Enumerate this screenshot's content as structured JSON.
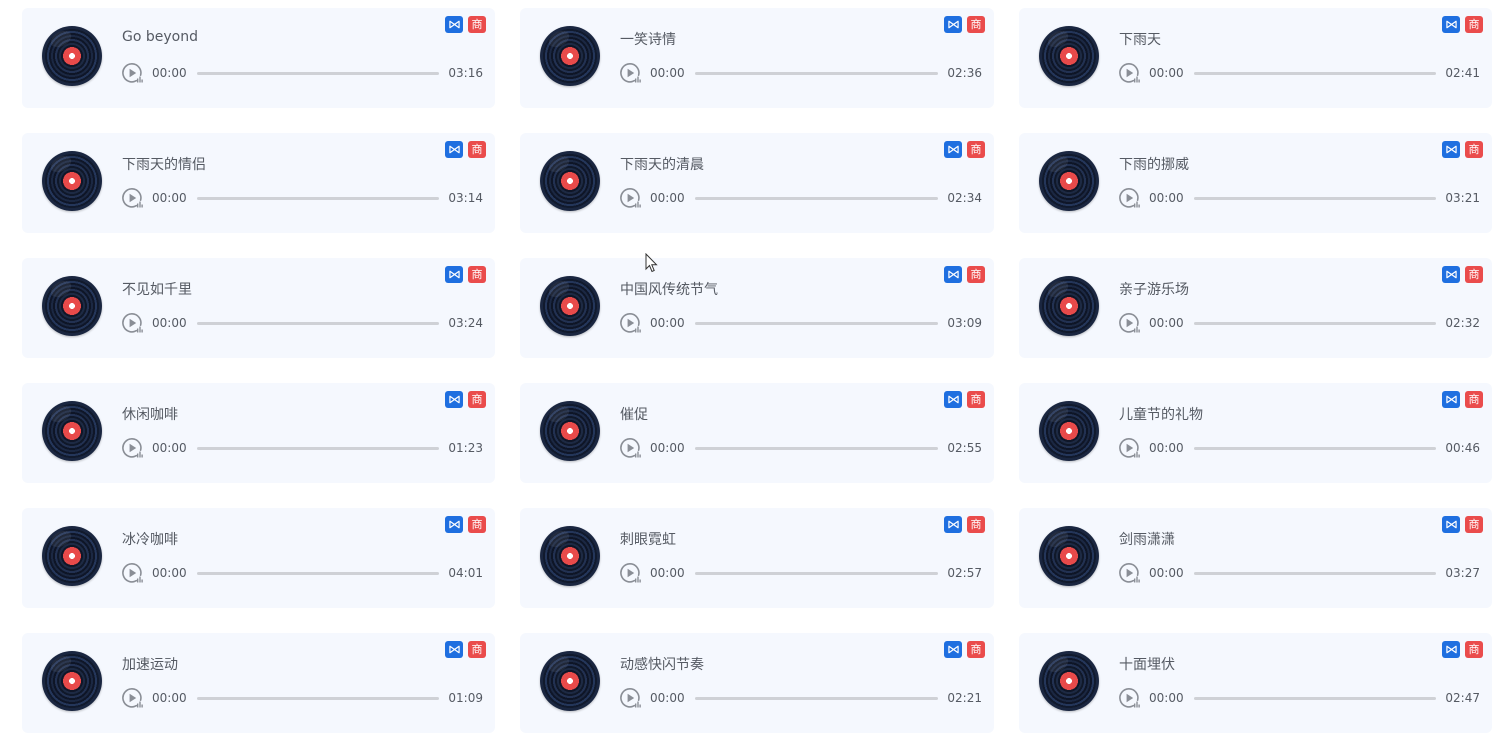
{
  "badges": {
    "format_label": "⋈",
    "commercial_label": "商"
  },
  "tracks": [
    {
      "title": "Go beyond",
      "current": "00:00",
      "duration": "03:16",
      "progress": 0
    },
    {
      "title": "一笑诗情",
      "current": "00:00",
      "duration": "02:36",
      "progress": 0
    },
    {
      "title": "下雨天",
      "current": "00:00",
      "duration": "02:41",
      "progress": 0
    },
    {
      "title": "下雨天的情侣",
      "current": "00:00",
      "duration": "03:14",
      "progress": 0
    },
    {
      "title": "下雨天的清晨",
      "current": "00:00",
      "duration": "02:34",
      "progress": 0
    },
    {
      "title": "下雨的挪威",
      "current": "00:00",
      "duration": "03:21",
      "progress": 0
    },
    {
      "title": "不见如千里",
      "current": "00:00",
      "duration": "03:24",
      "progress": 0
    },
    {
      "title": "中国风传统节气",
      "current": "00:00",
      "duration": "03:09",
      "progress": 0
    },
    {
      "title": "亲子游乐场",
      "current": "00:00",
      "duration": "02:32",
      "progress": 0
    },
    {
      "title": "休闲咖啡",
      "current": "00:00",
      "duration": "01:23",
      "progress": 0
    },
    {
      "title": "催促",
      "current": "00:00",
      "duration": "02:55",
      "progress": 0
    },
    {
      "title": "儿童节的礼物",
      "current": "00:00",
      "duration": "00:46",
      "progress": 0
    },
    {
      "title": "冰冷咖啡",
      "current": "00:00",
      "duration": "04:01",
      "progress": 0
    },
    {
      "title": "刺眼霓虹",
      "current": "00:00",
      "duration": "02:57",
      "progress": 0
    },
    {
      "title": "剑雨潇潇",
      "current": "00:00",
      "duration": "03:27",
      "progress": 0
    },
    {
      "title": "加速运动",
      "current": "00:00",
      "duration": "01:09",
      "progress": 0
    },
    {
      "title": "动感快闪节奏",
      "current": "00:00",
      "duration": "02:21",
      "progress": 0
    },
    {
      "title": "十面埋伏",
      "current": "00:00",
      "duration": "02:47",
      "progress": 0
    }
  ]
}
